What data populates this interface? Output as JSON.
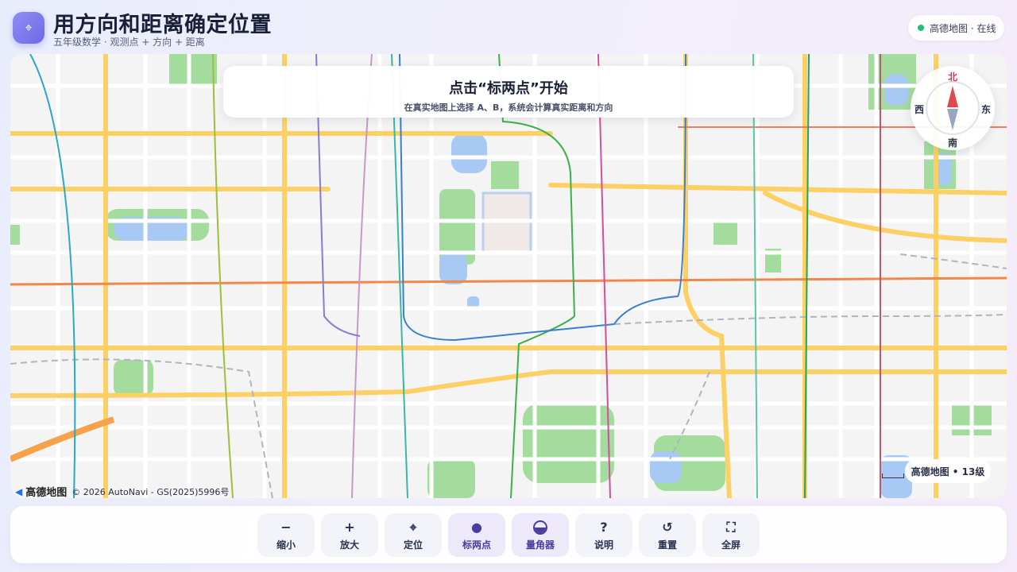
{
  "header": {
    "icon": "locate-icon",
    "title": "用方向和距离确定位置",
    "subtitle": "五年级数学 · 观测点 + 方向 + 距离",
    "status": "高德地图 · 在线",
    "status_color": "#1fbf7a"
  },
  "map": {
    "hint_title": "点击“标两点”开始",
    "hint_subtitle": "在真实地图上选择 A、B，系统会计算真实距离和方向",
    "compass": {
      "north": "北",
      "south": "南",
      "west": "西",
      "east": "东"
    },
    "scale_label": "高德地图 • 13级",
    "logo_text": "高德地图",
    "attribution": "© 2026 AutoNavi - GS(2025)5996号"
  },
  "toolbar": {
    "items": [
      {
        "icon": "minus-icon",
        "label": "缩小"
      },
      {
        "icon": "plus-icon",
        "label": "放大"
      },
      {
        "icon": "locate-icon",
        "label": "定位"
      },
      {
        "icon": "dot-icon",
        "label": "标两点"
      },
      {
        "icon": "protractor-icon",
        "label": "量角器"
      },
      {
        "icon": "help-icon",
        "label": "说明"
      },
      {
        "icon": "reset-icon",
        "label": "重置"
      },
      {
        "icon": "fullscreen-icon",
        "label": "全屏"
      }
    ]
  },
  "colors": {
    "accent": "#6c6ae6",
    "major_road": "#fdd066",
    "ring_road": "#f2874a",
    "park": "#a3dc9c",
    "water": "#a9c9f5"
  }
}
